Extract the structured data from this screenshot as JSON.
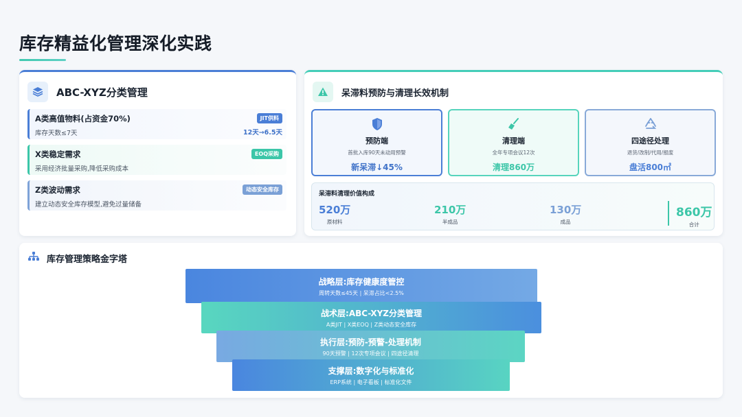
{
  "page": {
    "title": "库存精益化管理深化实践"
  },
  "abc": {
    "title": "ABC-XYZ分类管理",
    "icon": "layers-icon",
    "items": [
      {
        "name": "A类高值物料(占资金70%)",
        "desc": "库存天数≤7天",
        "tag": "JIT供料",
        "extra": "12天→6.5天"
      },
      {
        "name": "X类稳定需求",
        "desc": "采用经济批量采购,降低采购成本",
        "tag": "EOQ采购"
      },
      {
        "name": "Z类波动需求",
        "desc": "建立动态安全库存模型,避免过量储备",
        "tag": "动态安全库存"
      }
    ]
  },
  "slow": {
    "title": "呆滞料预防与清理长效机制",
    "icon": "warning-icon",
    "phases": [
      {
        "title": "预防端",
        "desc": "首批入库90天未动用预警",
        "metric": "新呆滞↓45%",
        "icon": "shield-icon"
      },
      {
        "title": "清理端",
        "desc": "全年专项会议12次",
        "metric": "清理860万",
        "icon": "broom-icon"
      },
      {
        "title": "四途径处理",
        "desc": "退货/改制/代用/报废",
        "metric": "盘活800㎡",
        "icon": "recycle-icon"
      }
    ],
    "value": {
      "title": "呆滞料清理价值构成",
      "items": [
        {
          "num": "520万",
          "label": "原材料"
        },
        {
          "num": "210万",
          "label": "半成品"
        },
        {
          "num": "130万",
          "label": "成品"
        },
        {
          "num": "860万",
          "label": "合计"
        }
      ]
    }
  },
  "pyramid": {
    "title": "库存管理策略金字塔",
    "icon": "hierarchy-icon",
    "layers": [
      {
        "title": "战略层:库存健康度管控",
        "desc": "周转天数≤45天 | 呆滞占比<2.5%"
      },
      {
        "title": "战术层:ABC-XYZ分类管理",
        "desc": "A类JIT | X类EOQ | Z类动态安全库存"
      },
      {
        "title": "执行层:预防-预警-处理机制",
        "desc": "90天预警 | 12次专项会议 | 四途径清理"
      },
      {
        "title": "支撑层:数字化与标准化",
        "desc": "ERP系统 | 电子看板 | 标准化文件"
      }
    ]
  },
  "colors": {
    "blue": "#4a7ed6",
    "teal": "#3cc6a8",
    "lightblue": "#7aa0d6"
  }
}
